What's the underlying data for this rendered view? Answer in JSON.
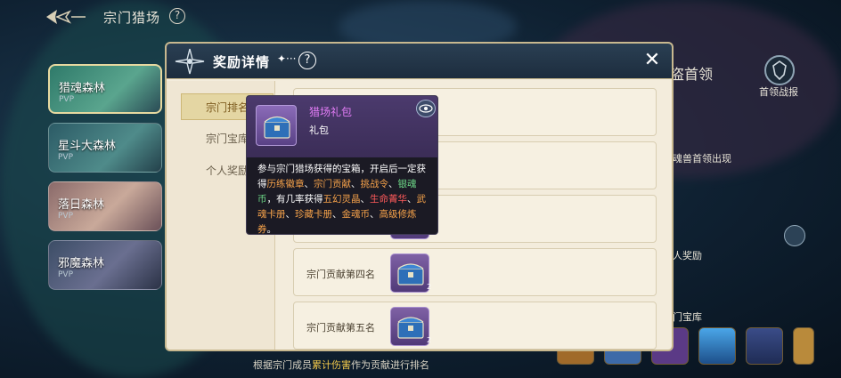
{
  "topbar": {
    "title": "宗门猎场",
    "help": "?"
  },
  "maps": [
    {
      "name": "猎魂森林",
      "tag": "PVP"
    },
    {
      "name": "星斗大森林",
      "tag": "PVP"
    },
    {
      "name": "落日森林",
      "tag": "PVP"
    },
    {
      "name": "邪魔森林",
      "tag": "PVP"
    }
  ],
  "behind": {
    "boss_title": "盗首领",
    "boss_report": "首领战报",
    "boss_appear": "魂兽首领出现",
    "personal_reward": "人奖励",
    "guild_vault": "门宝库"
  },
  "modal": {
    "title": "奖励详情",
    "sparkle": "✦···",
    "help": "?",
    "close": "✕",
    "tabs": [
      "宗门排名",
      "宗门宝库",
      "个人奖励"
    ],
    "rows": [
      {
        "name": "",
        "count": ""
      },
      {
        "name": "",
        "count": ""
      },
      {
        "name": "",
        "count": ""
      },
      {
        "name": "宗门贡献第四名",
        "count": "2"
      },
      {
        "name": "宗门贡献第五名",
        "count": "2"
      }
    ]
  },
  "tooltip": {
    "item_name": "猎场礼包",
    "item_type": "礼包",
    "desc": {
      "p1": "参与宗门猎场获得的宝箱，开启后一定获得",
      "r1": "历练徽章",
      "s1": "、",
      "r2": "宗门贡献",
      "s2": "、",
      "r3": "挑战令",
      "s3": "、",
      "r4": "银魂币",
      "p2": "，有几率获得",
      "r5": "五幻灵晶",
      "s4": "、",
      "r6": "生命菁华",
      "s5": "、",
      "r7": "武魂卡册",
      "s6": "、",
      "r8": "珍藏卡册",
      "s7": "、",
      "r9": "金魂币",
      "s8": "、",
      "r10": "高级修炼券",
      "p3": "。"
    }
  },
  "bottom_note": {
    "pre": "根据宗门成员",
    "hl": "累计伤害",
    "post": "作为贡献进行排名"
  }
}
